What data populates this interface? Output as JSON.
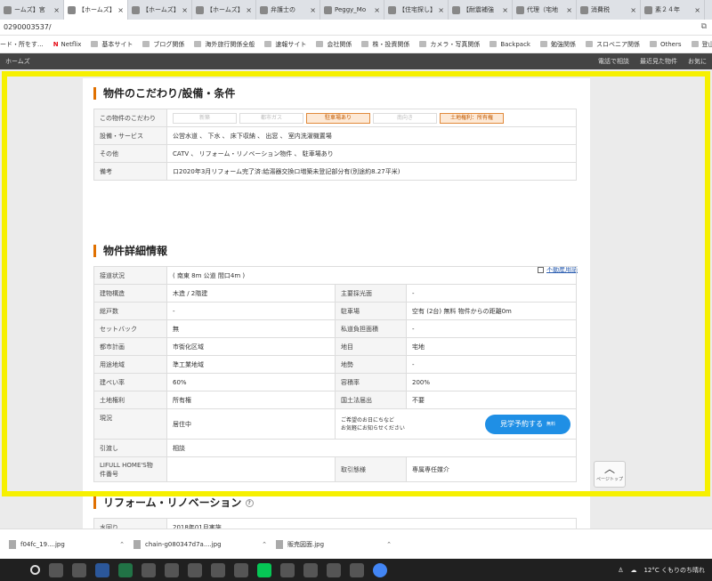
{
  "browser": {
    "tabs": [
      {
        "label": "ームズ】宮",
        "active": false
      },
      {
        "label": "【ホームズ】中",
        "active": true
      },
      {
        "label": "【ホームズ】山",
        "active": false
      },
      {
        "label": "【ホームズ】帯",
        "active": false
      },
      {
        "label": "弁護士の",
        "active": false
      },
      {
        "label": "Peggy_Mo",
        "active": false
      },
      {
        "label": "【住宅探し】",
        "active": false
      },
      {
        "label": "【耐震補強",
        "active": false
      },
      {
        "label": "代理（宅地",
        "active": false
      },
      {
        "label": "消費税",
        "active": false
      },
      {
        "label": "素２４年",
        "active": false
      }
    ],
    "url": "0290003537/",
    "bookmarks": [
      "ード・所をす...",
      "Netflix",
      "基本サイト",
      "ブログ関係",
      "海外旅行関係全般",
      "速報サイト",
      "会社関係",
      "株・投資関係",
      "カメラ・写真関係",
      "Backpack",
      "勉強関係",
      "スロベニア関係",
      "Others",
      "登山関"
    ],
    "site_left": "ホームズ",
    "site_links": [
      "電話で相談",
      "最近見た物件",
      "お気に"
    ]
  },
  "kodawari": {
    "title": "物件のこだわり/設備・条件",
    "rows": [
      {
        "label": "この物件のこだわり",
        "chips": [
          {
            "text": "新築",
            "on": false
          },
          {
            "text": "都市ガス",
            "on": false
          },
          {
            "text": "駐車場あり",
            "on": true
          },
          {
            "text": "南向き",
            "on": false
          },
          {
            "text": "土地権利：所有権",
            "on": true
          }
        ]
      },
      {
        "label": "設備・サービス",
        "value": "公営水道 、 下水 、 床下収納 、 出窓 、 室内洗濯機置場"
      },
      {
        "label": "その他",
        "value": "CATV 、 リフォーム・リノベーション物件 、 駐車場あり"
      },
      {
        "label": "備考",
        "value": "ロ2020年3月リフォーム完了済:給湯器交換ロ増築未登記部分有(別途約8.27平米)"
      }
    ]
  },
  "details": {
    "title": "物件詳細情報",
    "glossary": "不動産用語",
    "access_label": "接道状況",
    "access_value": "( 南東 8m 公道 間口4m )",
    "rows": [
      {
        "l1": "建物構造",
        "v1": "木造 / 2階建",
        "l2": "主要採光面",
        "v2": "-"
      },
      {
        "l1": "総戸数",
        "v1": "-",
        "l2": "駐車場",
        "v2": "空有 (2台) 無料 物件からの距離0m"
      },
      {
        "l1": "セットバック",
        "v1": "無",
        "l2": "私道負担面積",
        "v2": "-"
      },
      {
        "l1": "都市計画",
        "v1": "市街化区域",
        "l2": "地目",
        "v2": "宅地"
      },
      {
        "l1": "用途地域",
        "v1": "準工業地域",
        "l2": "地勢",
        "v2": "-"
      },
      {
        "l1": "建ぺい率",
        "v1": "60%",
        "l2": "容積率",
        "v2": "200%"
      },
      {
        "l1": "土地権利",
        "v1": "所有権",
        "l2": "国土法届出",
        "v2": "不要"
      }
    ],
    "status_label": "現況",
    "status_value": "居住中",
    "contact_line1": "ご希望のお日にちなど",
    "contact_line2": "お気軽にお知らせください",
    "reserve_button": "見学予約する",
    "reserve_free": "無料",
    "handover_label": "引渡し",
    "handover_value": "相談",
    "id_label_1": "LIFULL HOME'S物",
    "id_label_2": "件番号",
    "id_value": "",
    "deal_label": "取引態様",
    "deal_value": "専属専任媒介"
  },
  "reform": {
    "title": "リフォーム・リノベーション",
    "help": "?",
    "first_label": "水回り",
    "first_value": "2018年01月実施"
  },
  "page_top": "ページトップ",
  "downloads": [
    "f04fc_19....jpg",
    "chain-g080347d7a....jpg",
    "販売図面.jpg"
  ],
  "taskbar": {
    "weather": "12°C くもりのち晴れ"
  },
  "colors": {
    "highlight": "#f6f000",
    "accent": "#e07000",
    "button": "#1f8fe5"
  }
}
